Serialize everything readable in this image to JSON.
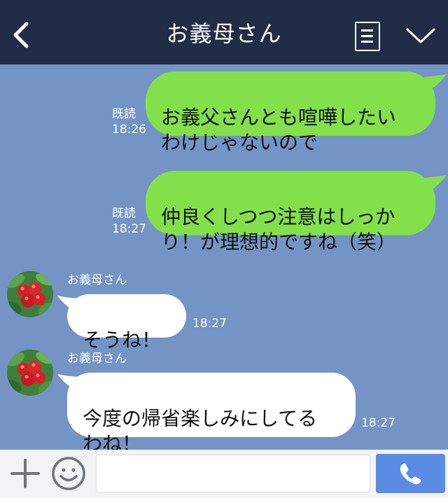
{
  "header": {
    "title": "お義母さん",
    "back_icon": "chevron-left-icon",
    "menu_icon": "menu-list-icon",
    "collapse_icon": "chevron-down-icon"
  },
  "messages": [
    {
      "direction": "outgoing",
      "text": "お義父さんとも喧嘩したい\nわけじゃないので",
      "read_label": "既読",
      "time": "18:26"
    },
    {
      "direction": "outgoing",
      "text": "仲良くしつつ注意はしっか\nり！が理想的ですね（笑）",
      "read_label": "既読",
      "time": "18:27"
    },
    {
      "direction": "incoming",
      "sender": "お義母さん",
      "text": "そうね！",
      "time": "18:27"
    },
    {
      "direction": "incoming",
      "sender": "お義母さん",
      "text": "今度の帰省楽しみにしてる\nわね！",
      "time": "18:27"
    }
  ],
  "footer": {
    "plus_icon": "plus-icon",
    "emoji_icon": "smiley-icon",
    "input_value": "",
    "input_placeholder": "",
    "call_icon": "phone-icon"
  },
  "colors": {
    "header_bg": "#222c46",
    "chat_bg": "#7394c5",
    "outgoing_bubble": "#84e04a",
    "incoming_bubble": "#ffffff",
    "call_button": "#5b8ce4"
  }
}
